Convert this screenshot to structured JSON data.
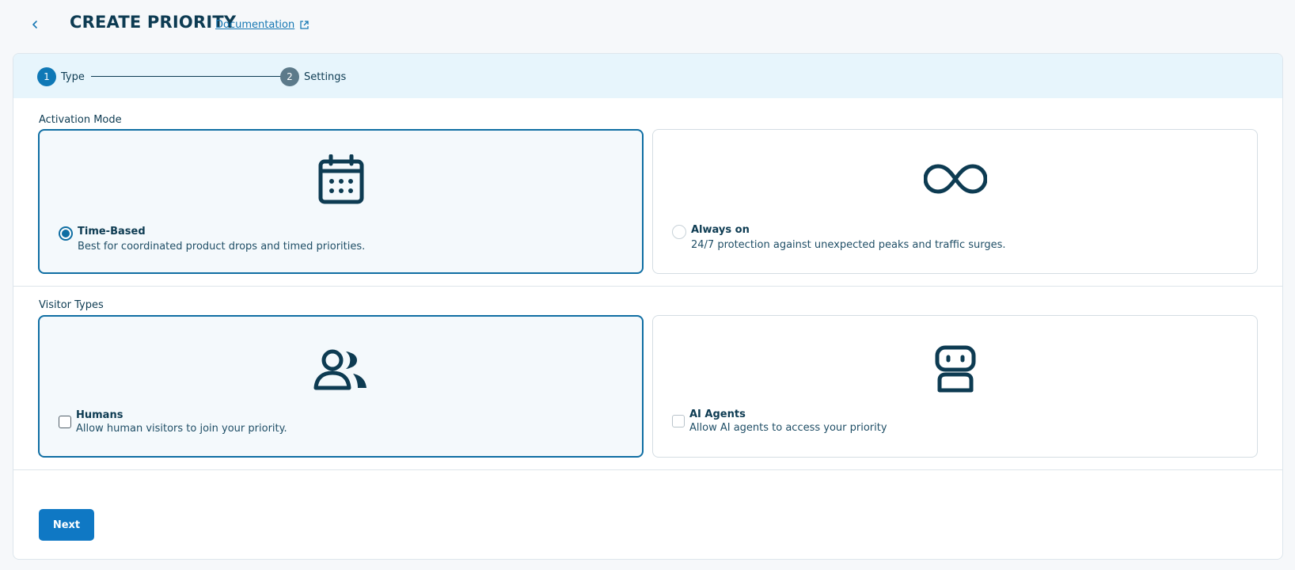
{
  "header": {
    "title": "CREATE PRIORITY",
    "doc_link": "Documentation"
  },
  "stepper": {
    "steps": [
      {
        "num": "1",
        "label": "Type"
      },
      {
        "num": "2",
        "label": "Settings"
      }
    ]
  },
  "activation": {
    "label": "Activation Mode",
    "options": [
      {
        "title": "Time-Based",
        "desc": "Best for coordinated product drops and timed priorities.",
        "icon": "calendar-icon"
      },
      {
        "title": "Always on",
        "desc": "24/7 protection against unexpected peaks and traffic surges.",
        "icon": "infinity-icon"
      }
    ]
  },
  "visitors": {
    "label": "Visitor Types",
    "options": [
      {
        "title": "Humans",
        "desc": "Allow human visitors to join your priority.",
        "icon": "users-icon"
      },
      {
        "title": "AI Agents",
        "desc": "Allow AI agents to access your priority",
        "icon": "robot-icon"
      }
    ]
  },
  "actions": {
    "next": "Next"
  },
  "colors": {
    "primary": "#0f78c4",
    "text_dark": "#0d3b52",
    "stepper_bg": "#e7f5fc",
    "selected_border": "#0f6ea3"
  }
}
